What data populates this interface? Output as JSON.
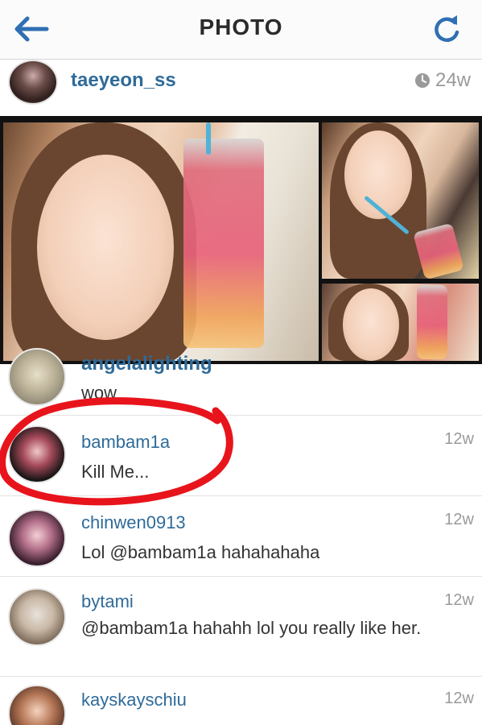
{
  "header": {
    "title": "PHOTO",
    "back_icon": "back-arrow-icon",
    "refresh_icon": "refresh-icon",
    "accent_color": "#2f6fb3"
  },
  "post": {
    "username": "taeyeon_ss",
    "time": "24w",
    "time_icon": "clock-icon"
  },
  "comments": [
    {
      "username": "angelalighting",
      "text": "wow",
      "time": ""
    },
    {
      "username": "bambam1a",
      "text": "Kill Me...",
      "time": "12w"
    },
    {
      "username": "chinwen0913",
      "text": "Lol @bambam1a hahahahaha",
      "time": "12w"
    },
    {
      "username": "bytami",
      "text": "@bambam1a hahahh lol you really like her.",
      "time": "12w"
    },
    {
      "username": "kayskayschiu",
      "text": "",
      "time": "12w"
    }
  ],
  "annotation": {
    "color": "#e8141c",
    "shape": "hand-drawn-circle"
  }
}
